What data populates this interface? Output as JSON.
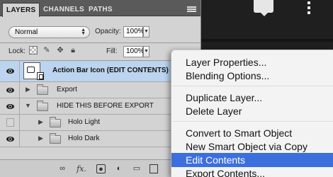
{
  "panel": {
    "tabs": [
      "LAYERS",
      "CHANNELS",
      "PATHS"
    ],
    "active_tab": "LAYERS",
    "blend_mode": "Normal",
    "opacity_label": "Opacity:",
    "opacity_value": "100%",
    "lock_label": "Lock:",
    "fill_label": "Fill:",
    "fill_value": "100%"
  },
  "layers": [
    {
      "name": "Action Bar Icon (EDIT CONTENTS)",
      "visible": true,
      "type": "smart-object",
      "selected": true
    },
    {
      "name": "Export",
      "visible": true,
      "type": "group",
      "expanded": false,
      "indent": 0
    },
    {
      "name": "HIDE THIS BEFORE EXPORT",
      "visible": true,
      "type": "group",
      "expanded": true,
      "indent": 0
    },
    {
      "name": "Holo Light",
      "visible": false,
      "type": "group",
      "expanded": false,
      "indent": 1
    },
    {
      "name": "Holo Dark",
      "visible": true,
      "type": "group",
      "expanded": false,
      "indent": 1
    }
  ],
  "toolbar_icons": [
    "link-icon",
    "fx-icon",
    "mask-icon",
    "adjustment-icon",
    "folder-icon",
    "new-layer-icon",
    "trash-icon"
  ],
  "toolbar_fx": "fx.",
  "context_menu": {
    "items": [
      "Layer Properties...",
      "Blending Options...",
      "Duplicate Layer...",
      "Delete Layer",
      "Convert to Smart Object",
      "New Smart Object via Copy",
      "Edit Contents",
      "Export Contents..."
    ],
    "highlighted": "Edit Contents",
    "highlight_color": "#3b6fde"
  },
  "colors": {
    "panel_bg": "#d3d3d3",
    "selected_layer": "#bcd4ef",
    "canvas_bg": "#1f1f1f"
  }
}
